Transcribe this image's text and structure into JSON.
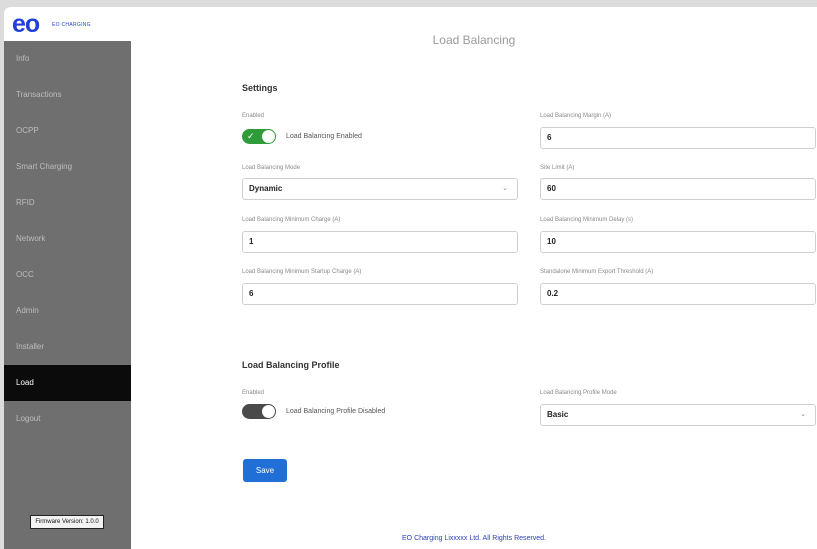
{
  "logo": {
    "mark": "eo",
    "text": "EO CHARGING"
  },
  "sidebar": {
    "items": [
      {
        "label": "Info"
      },
      {
        "label": "Transactions"
      },
      {
        "label": "OCPP"
      },
      {
        "label": "Smart Charging"
      },
      {
        "label": "RFID"
      },
      {
        "label": "Network"
      },
      {
        "label": "OCC"
      },
      {
        "label": "Admin"
      },
      {
        "label": "Installer"
      },
      {
        "label": "Load"
      },
      {
        "label": "Logout"
      }
    ],
    "active": "Load",
    "firmware": "Firmware Version: 1.0.0"
  },
  "page": {
    "title": "Load Balancing"
  },
  "settings": {
    "title": "Settings",
    "enabled_label": "Enabled",
    "enabled_state": "on",
    "enabled_text": "Load Balancing Enabled",
    "mode_label": "Load Balancing Mode",
    "mode_value": "Dynamic",
    "min_charge_label": "Load Balancing Minimum Charge (A)",
    "min_charge_value": "1",
    "min_startup_label": "Load Balancing Minimum Startup Charge (A)",
    "min_startup_value": "6",
    "margin_label": "Load Balancing Margin (A)",
    "margin_value": "6",
    "site_limit_label": "Site Limit (A)",
    "site_limit_value": "60",
    "min_delay_label": "Load Balancing Minimum Delay (s)",
    "min_delay_value": "10",
    "threshold_label": "Standalone Minimum Export Threshold (A)",
    "threshold_value": "0.2"
  },
  "profile": {
    "title": "Load Balancing Profile",
    "enabled_label": "Enabled",
    "enabled_state": "off",
    "enabled_text": "Load Balancing Profile Disabled",
    "mode_label": "Load Balancing Profile Mode",
    "mode_value": "Basic"
  },
  "actions": {
    "save": "Save"
  },
  "footer": {
    "text": "EO Charging Lixxxxx Ltd. All Rights Reserved."
  },
  "colors": {
    "toggle_on": "#2e9c3a",
    "save": "#1f6fd6",
    "active_nav": "#0b0b0b"
  }
}
